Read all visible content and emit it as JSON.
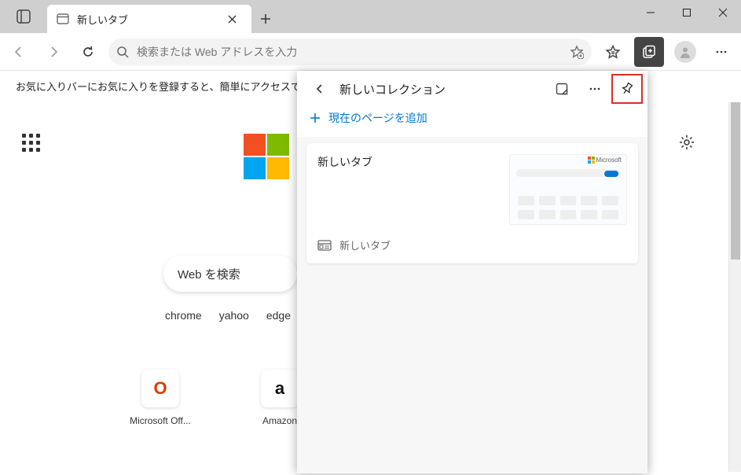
{
  "tab": {
    "title": "新しいタブ"
  },
  "addressbar": {
    "placeholder": "検索または Web アドレスを入力"
  },
  "favbar": {
    "message": "お気に入りバーにお気に入りを登録すると、簡単にアクセスで"
  },
  "search": {
    "placeholder": "Web を検索"
  },
  "quicklinks": [
    "chrome",
    "yahoo",
    "edge"
  ],
  "tiles": [
    {
      "label": "Microsoft Off...",
      "glyph": "O",
      "color": "#d83b01"
    },
    {
      "label": "Amazon",
      "glyph": "a",
      "color": "#111"
    }
  ],
  "panel": {
    "title": "新しいコレクション",
    "add_label": "現在のページを追加",
    "card": {
      "title": "新しいタブ",
      "source": "新しいタブ",
      "thumb_brand": "Microsoft"
    }
  }
}
